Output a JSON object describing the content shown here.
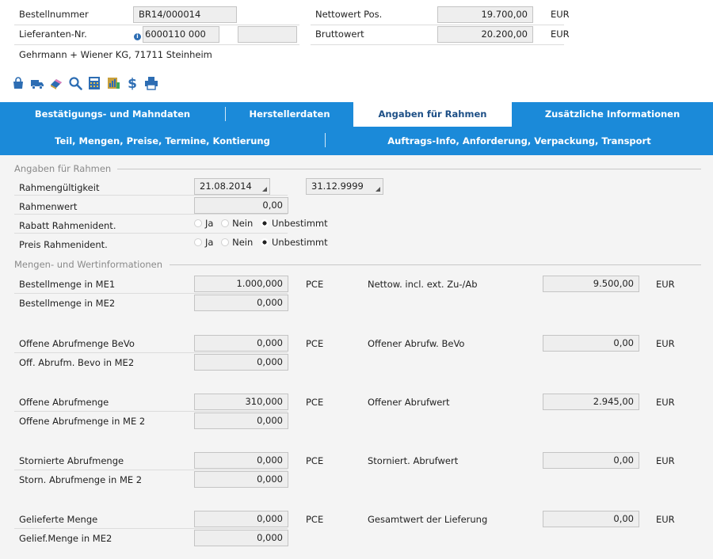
{
  "header": {
    "order_number_label": "Bestellnummer",
    "order_number_value": "BR14/000014",
    "supplier_no_label": "Lieferanten-Nr.",
    "supplier_no_value": "6000110 000",
    "supplier_no_extra_value": "",
    "supplier_name": "Gehrmann + Wiener KG, 71711 Steinheim",
    "net_value_label": "Nettowert Pos.",
    "net_value": "19.700,00",
    "net_currency": "EUR",
    "gross_value_label": "Bruttowert",
    "gross_value": "20.200,00",
    "gross_currency": "EUR"
  },
  "toolbar": {
    "icons": [
      "shopping-bag-icon",
      "truck-icon",
      "eraser-icon",
      "search-icon",
      "calculator-icon",
      "report-icon",
      "dollar-icon",
      "printer-icon"
    ],
    "dollar_glyph": "$"
  },
  "tabs_primary": [
    {
      "label": "Bestätigungs- und Mahndaten",
      "active": false
    },
    {
      "label": "Herstellerdaten",
      "active": false
    },
    {
      "label": "Angaben für Rahmen",
      "active": true
    },
    {
      "label": "Zusätzliche Informationen",
      "active": false
    }
  ],
  "tabs_secondary": [
    {
      "label": "Teil, Mengen, Preise, Termine, Kontierung"
    },
    {
      "label": "Auftrags-Info, Anforderung, Verpackung, Transport"
    }
  ],
  "frame_section": {
    "title": "Angaben für Rahmen",
    "validity_label": "Rahmengültigkeit",
    "validity_from": "21.08.2014",
    "validity_to": "31.12.9999",
    "frame_value_label": "Rahmenwert",
    "frame_value": "0,00",
    "discount_label": "Rabatt Rahmenident.",
    "price_label": "Preis Rahmenident.",
    "radio_options": [
      "Ja",
      "Nein",
      "Unbestimmt"
    ],
    "discount_selected": "Unbestimmt",
    "price_selected": "Unbestimmt"
  },
  "quantities_section": {
    "title": "Mengen- und Wertinformationen",
    "groups": [
      {
        "qty_label": "Bestellmenge in ME1",
        "qty_value": "1.000,000",
        "unit": "PCE",
        "qty2_label": "Bestellmenge in ME2",
        "qty2_value": "0,000",
        "amount_label": "Nettow. incl. ext. Zu-/Ab",
        "amount_value": "9.500,00",
        "currency": "EUR"
      },
      {
        "qty_label": "Offene Abrufmenge BeVo",
        "qty_value": "0,000",
        "unit": "PCE",
        "qty2_label": "Off. Abrufm. Bevo in ME2",
        "qty2_value": "0,000",
        "amount_label": "Offener Abrufw. BeVo",
        "amount_value": "0,00",
        "currency": "EUR"
      },
      {
        "qty_label": "Offene Abrufmenge",
        "qty_value": "310,000",
        "unit": "PCE",
        "qty2_label": "Offene Abrufmenge in ME 2",
        "qty2_value": "0,000",
        "amount_label": "Offener Abrufwert",
        "amount_value": "2.945,00",
        "currency": "EUR"
      },
      {
        "qty_label": "Stornierte Abrufmenge",
        "qty_value": "0,000",
        "unit": "PCE",
        "qty2_label": "Storn. Abrufmenge in ME 2",
        "qty2_value": "0,000",
        "amount_label": "Storniert. Abrufwert",
        "amount_value": "0,00",
        "currency": "EUR"
      },
      {
        "qty_label": "Gelieferte Menge",
        "qty_value": "0,000",
        "unit": "PCE",
        "qty2_label": "Gelief.Menge in ME2",
        "qty2_value": "0,000",
        "amount_label": "Gesamtwert der Lieferung",
        "amount_value": "0,00",
        "currency": "EUR"
      }
    ]
  },
  "colors": {
    "tab_blue": "#1b8ad9",
    "active_tab_text": "#1d4f86",
    "icon_blue": "#2d6db3"
  }
}
